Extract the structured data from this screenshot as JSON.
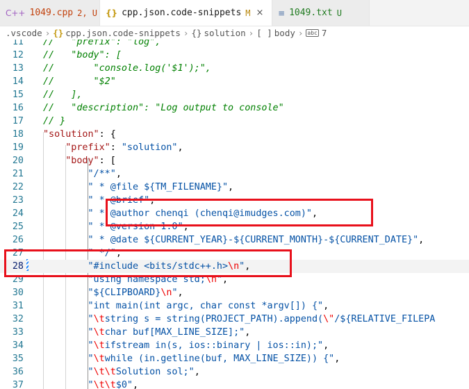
{
  "tabs": [
    {
      "icon": "cpp-file-icon",
      "icon_glyph": "C++",
      "title": "1049.cpp",
      "status": "2, U"
    },
    {
      "icon": "json-braces-icon",
      "icon_glyph": "{}",
      "title": "cpp.json.code-snippets",
      "status": "M",
      "close": "×"
    },
    {
      "icon": "text-file-icon",
      "icon_glyph": "≡",
      "title": "1049.txt",
      "status": "U"
    }
  ],
  "breadcrumb": {
    "folder": ".vscode",
    "file": "cpp.json.code-snippets",
    "object": "solution",
    "array": "body",
    "item": "7"
  },
  "editor": {
    "current_line": 28,
    "lines": [
      {
        "n": "11",
        "segs": [
          [
            "//   \"prefix\": \"log\",",
            "com"
          ]
        ]
      },
      {
        "n": "12",
        "segs": [
          [
            "//   \"body\": [",
            "com"
          ]
        ]
      },
      {
        "n": "13",
        "segs": [
          [
            "//       \"console.log('$1');\",",
            "com"
          ]
        ]
      },
      {
        "n": "14",
        "segs": [
          [
            "//       \"$2\"",
            "com"
          ]
        ]
      },
      {
        "n": "15",
        "segs": [
          [
            "//   ],",
            "com"
          ]
        ]
      },
      {
        "n": "16",
        "segs": [
          [
            "//   \"description\": \"Log output to console\"",
            "com"
          ]
        ]
      },
      {
        "n": "17",
        "segs": [
          [
            "// }",
            "com"
          ]
        ]
      },
      {
        "n": "18",
        "segs": [
          [
            "\"solution\"",
            "key"
          ],
          [
            ": {",
            "pun"
          ]
        ]
      },
      {
        "n": "19",
        "segs": [
          [
            "    ",
            "pun"
          ],
          [
            "\"prefix\"",
            "key"
          ],
          [
            ": ",
            "pun"
          ],
          [
            "\"solution\"",
            "str"
          ],
          [
            ",",
            "pun"
          ]
        ]
      },
      {
        "n": "20",
        "segs": [
          [
            "    ",
            "pun"
          ],
          [
            "\"body\"",
            "key"
          ],
          [
            ": [",
            "pun"
          ]
        ]
      },
      {
        "n": "21",
        "segs": [
          [
            "        ",
            "pun"
          ],
          [
            "\"/**\"",
            "str"
          ],
          [
            ",",
            "pun"
          ]
        ]
      },
      {
        "n": "22",
        "segs": [
          [
            "        ",
            "pun"
          ],
          [
            "\" * @file ${TM_FILENAME}\"",
            "str"
          ],
          [
            ",",
            "pun"
          ]
        ]
      },
      {
        "n": "23",
        "segs": [
          [
            "        ",
            "pun"
          ],
          [
            "\" * @brief\"",
            "str"
          ],
          [
            ",",
            "pun"
          ]
        ]
      },
      {
        "n": "24",
        "segs": [
          [
            "        ",
            "pun"
          ],
          [
            "\" * @author chenqi (chenqi@imudges.com)\"",
            "str"
          ],
          [
            ",",
            "pun"
          ]
        ]
      },
      {
        "n": "25",
        "segs": [
          [
            "        ",
            "pun"
          ],
          [
            "\" * @version 1.0\"",
            "str"
          ],
          [
            ",",
            "pun"
          ]
        ]
      },
      {
        "n": "26",
        "segs": [
          [
            "        ",
            "pun"
          ],
          [
            "\" * @date ${CURRENT_YEAR}-${CURRENT_MONTH}-${CURRENT_DATE}\"",
            "str"
          ],
          [
            ",",
            "pun"
          ]
        ]
      },
      {
        "n": "27",
        "segs": [
          [
            "        ",
            "pun"
          ],
          [
            "\" */\"",
            "str"
          ],
          [
            ",",
            "pun"
          ]
        ]
      },
      {
        "n": "28",
        "segs": [
          [
            "        ",
            "pun"
          ],
          [
            "\"#include <bits/stdc++.h>",
            "str"
          ],
          [
            "\\n",
            "esc"
          ],
          [
            "\"",
            "str"
          ],
          [
            ",",
            "pun"
          ]
        ]
      },
      {
        "n": "29",
        "segs": [
          [
            "        ",
            "pun"
          ],
          [
            "\"using namespace std;",
            "str"
          ],
          [
            "\\n",
            "esc"
          ],
          [
            "\"",
            "str"
          ],
          [
            ",",
            "pun"
          ]
        ]
      },
      {
        "n": "30",
        "segs": [
          [
            "        ",
            "pun"
          ],
          [
            "\"${CLIPBOARD}",
            "str"
          ],
          [
            "\\n",
            "esc"
          ],
          [
            "\"",
            "str"
          ],
          [
            ",",
            "pun"
          ]
        ]
      },
      {
        "n": "31",
        "segs": [
          [
            "        ",
            "pun"
          ],
          [
            "\"int main(int argc, char const *argv[]) {\"",
            "str"
          ],
          [
            ",",
            "pun"
          ]
        ]
      },
      {
        "n": "32",
        "segs": [
          [
            "        ",
            "pun"
          ],
          [
            "\"",
            "str"
          ],
          [
            "\\t",
            "esc"
          ],
          [
            "string s = string(PROJECT_PATH).append(",
            "str"
          ],
          [
            "\\\"",
            "esc"
          ],
          [
            "/${RELATIVE_FILEPA",
            "str"
          ]
        ]
      },
      {
        "n": "33",
        "segs": [
          [
            "        ",
            "pun"
          ],
          [
            "\"",
            "str"
          ],
          [
            "\\t",
            "esc"
          ],
          [
            "char buf[MAX_LINE_SIZE];\"",
            "str"
          ],
          [
            ",",
            "pun"
          ]
        ]
      },
      {
        "n": "34",
        "segs": [
          [
            "        ",
            "pun"
          ],
          [
            "\"",
            "str"
          ],
          [
            "\\t",
            "esc"
          ],
          [
            "ifstream in(s, ios::binary | ios::in);\"",
            "str"
          ],
          [
            ",",
            "pun"
          ]
        ]
      },
      {
        "n": "35",
        "segs": [
          [
            "        ",
            "pun"
          ],
          [
            "\"",
            "str"
          ],
          [
            "\\t",
            "esc"
          ],
          [
            "while (in.getline(buf, MAX_LINE_SIZE)) {\"",
            "str"
          ],
          [
            ",",
            "pun"
          ]
        ]
      },
      {
        "n": "36",
        "segs": [
          [
            "        ",
            "pun"
          ],
          [
            "\"",
            "str"
          ],
          [
            "\\t\\t",
            "esc"
          ],
          [
            "Solution sol;\"",
            "str"
          ],
          [
            ",",
            "pun"
          ]
        ]
      },
      {
        "n": "37",
        "segs": [
          [
            "        ",
            "pun"
          ],
          [
            "\"",
            "str"
          ],
          [
            "\\t\\t",
            "esc"
          ],
          [
            "$0\"",
            "str"
          ],
          [
            ",",
            "pun"
          ]
        ]
      }
    ]
  },
  "colors": {
    "highlight_box": "#e8101b",
    "string": "#0451a5",
    "key": "#a31515",
    "comment": "#008000",
    "escape": "#ee0000",
    "line_number": "#237893"
  }
}
